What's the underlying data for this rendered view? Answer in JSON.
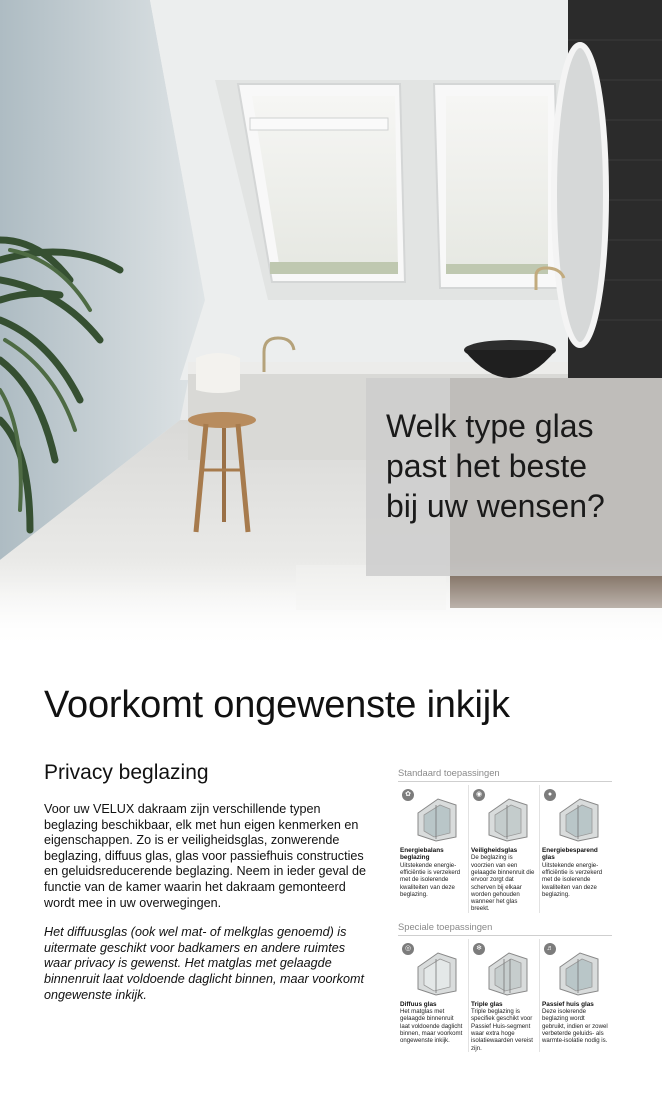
{
  "hero": {
    "title_lines": [
      "Welk type glas",
      "past het beste",
      "bij uw wensen?"
    ]
  },
  "article": {
    "headline": "Voorkomt ongewenste inkijk",
    "subheading": "Privacy beglazing",
    "paragraph_1": "Voor uw VELUX dakraam zijn verschillende typen beglazing beschikbaar, elk met hun eigen kenmerken en eigenschappen. Zo is er veiligheidsglas, zonwerende beglazing, diffuus glas, glas voor passiefhuis constructies en geluidsreducerende beglazing. Neem in ieder geval de functie van de kamer waarin het dakraam gemonteerd wordt mee in uw overwegingen.",
    "paragraph_2": "Het diffuusglas (ook wel mat- of melkglas genoemd) is uitermate geschikt voor badkamers en andere ruimtes waar privacy is gewenst. Het matglas met gelaagde binnenruit laat voldoende daglicht binnen, maar voorkomt ongewenste inkijk."
  },
  "applications": {
    "standard_label": "Standaard toepassingen",
    "special_label": "Speciale toepassingen",
    "standard": [
      {
        "icon": "leaf-icon",
        "title": "Energiebalans beglazing",
        "description": "Uitstekende energie-efficiëntie is verzekerd met de isolerende kwaliteiten van deze beglazing."
      },
      {
        "icon": "shield-icon",
        "title": "Veiligheidsglas",
        "description": "De beglazing is voorzien van een gelaagde binnenruit die ervoor zorgt dat scherven bij elkaar worden gehouden wanneer het glas breekt."
      },
      {
        "icon": "energy-icon",
        "title": "Energiebesparend glas",
        "description": "Uitstekende energie-efficiëntie is verzekerd met de isolerende kwaliteiten van deze beglazing."
      }
    ],
    "special": [
      {
        "icon": "eye-icon",
        "title": "Diffuus glas",
        "description": "Het matglas met gelaagde binnenruit laat voldoende daglicht binnen, maar voorkomt ongewenste inkijk."
      },
      {
        "icon": "snowflake-icon",
        "title": "Triple glas",
        "description": "Triple beglazing is specifiek geschikt voor Passief Huis-segment waar extra hoge isolatiewaarden vereist zijn."
      },
      {
        "icon": "sound-icon",
        "title": "Passief huis glas",
        "description": "Deze isolerende beglazing wordt gebruikt, indien er zowel verbeterde geluids- als warmte-isolatie nodig is."
      }
    ]
  },
  "colors": {
    "caption_bg": "#cdcdcd",
    "text": "#111111",
    "label_grey": "#8a8a8a",
    "badge_grey": "#7c7c7c"
  }
}
